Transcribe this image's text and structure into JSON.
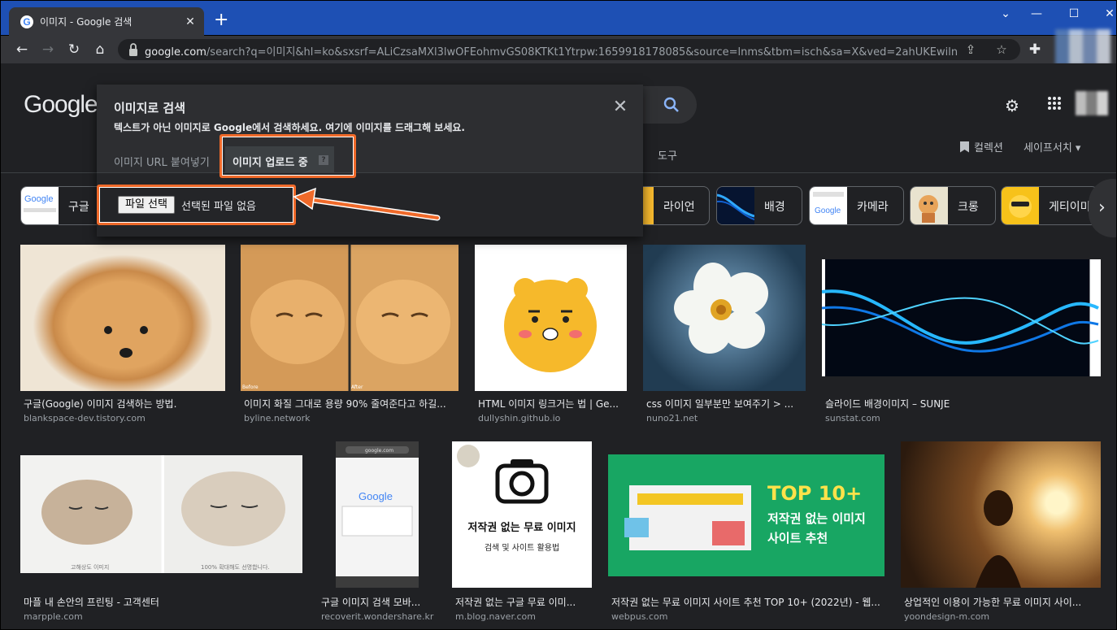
{
  "browser": {
    "tab_title": "이미지 - Google 검색",
    "tab_favicon": "G",
    "new_tab": "+",
    "url_host": "google.com",
    "url_path": "/search?q=이미지&hl=ko&sxsrf=ALiCzsaMXl3lwOFEohmvGS08KTKt1Ytrpw:1659918178085&source=lnms&tbm=isch&sa=X&ved=2ahUKEwilnPG..."
  },
  "header": {
    "logo": "Google",
    "tools": "도구",
    "collections": "컬렉션",
    "safesearch": "세이프서치 ▾"
  },
  "chips": [
    {
      "label": "구글"
    },
    {
      "label": "라이언"
    },
    {
      "label": "배경"
    },
    {
      "label": "카메라"
    },
    {
      "label": "크롱"
    },
    {
      "label": "게티이미"
    }
  ],
  "dialog": {
    "title": "이미지로 검색",
    "subtitle": "텍스트가 아닌 이미지로 Google에서 검색하세요. 여기에 이미지를 드래그해 보세요.",
    "tab_url": "이미지 URL 붙여넣기",
    "tab_upload": "이미지 업로드 중",
    "help": "?",
    "file_button": "파일 선택",
    "no_file": "선택된 파일 없음",
    "close": "✕"
  },
  "results": [
    {
      "title": "구글(Google) 이미지 검색하는 방법.",
      "source": "blankspace-dev.tistory.com"
    },
    {
      "title": "이미지 화질 그대로 용량 90% 줄여준다고 하길...",
      "source": "byline.network"
    },
    {
      "title": "HTML 이미지 링크거는 법 | Ge...",
      "source": "dullyshin.github.io"
    },
    {
      "title": "css 이미지 일부분만 보여주기 > ...",
      "source": "nuno21.net"
    },
    {
      "title": "슬라이드 배경이미지 – SUNJE",
      "source": "sunstat.com"
    },
    {
      "title": "마플 내 손안의 프린팅 - 고객센터",
      "source": "marpple.com"
    },
    {
      "title": "구글 이미지 검색 모바...",
      "source": "recoverit.wondershare.kr"
    },
    {
      "title": "저작권 없는 구글 무료 이미...",
      "source": "m.blog.naver.com"
    },
    {
      "title": "저작권 없는 무료 이미지 사이트 추천 TOP 10+ (2022년) - 웹...",
      "source": "webpus.com"
    },
    {
      "title": "상업적인 이용이 가능한 무료 이미지 사이...",
      "source": "yoondesign-m.com"
    }
  ],
  "thumb_texts": {
    "camera_title": "저작권 없는 무료 이미지",
    "camera_sub": "검색 및 사이트 활용법",
    "top10_title": "TOP 10+",
    "top10_line1": "저작권 없는 이미지",
    "top10_line2": "사이트 추천",
    "phone_logo": "Google",
    "phone_url": "google.com",
    "cat_cap1": "고해상도 이미지",
    "cat_cap2": "100% 확대해도 선명합니다.",
    "cat_compare_left": "Before",
    "cat_compare_right": "After"
  },
  "colors": {
    "annotation": "#f06a2a",
    "titlebar": "#1e50b4",
    "top10_bg": "#18a663",
    "top10_accent": "#ffe24a"
  }
}
